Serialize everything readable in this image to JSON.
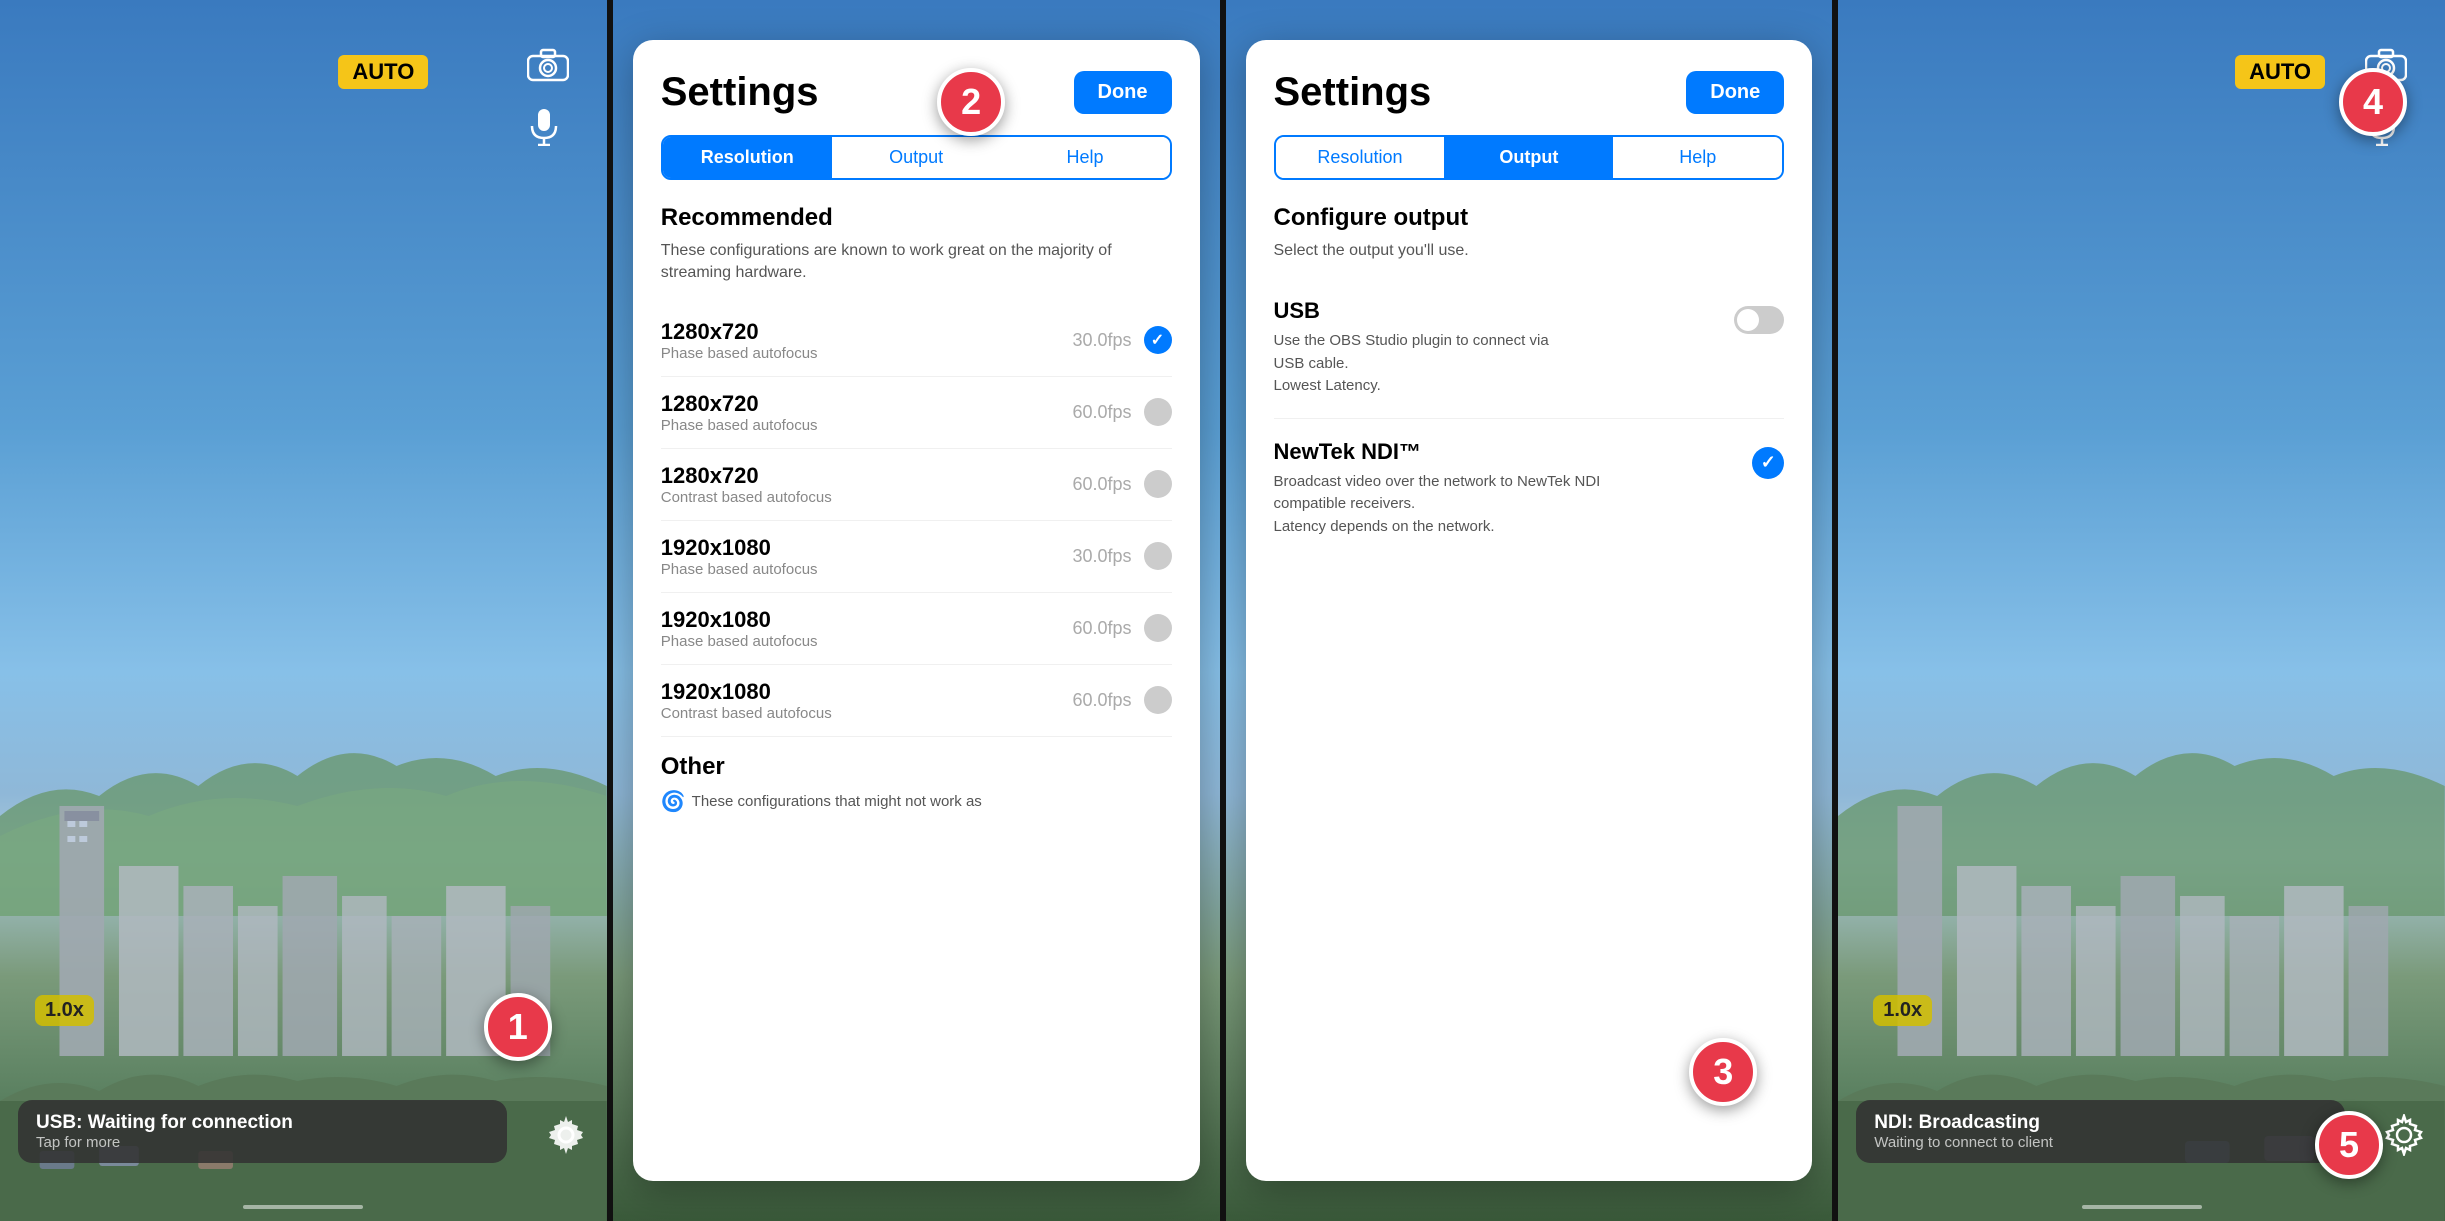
{
  "panels": {
    "panel1": {
      "type": "camera",
      "auto_badge": "AUTO",
      "zoom_badge": "1.0x",
      "status_main": "USB: Waiting for connection",
      "status_sub": "Tap for more",
      "step_number": "1"
    },
    "panel2": {
      "type": "settings",
      "title": "Settings",
      "done_label": "Done",
      "step_number": "2",
      "active_tab": "Resolution",
      "tabs": [
        "Resolution",
        "Output",
        "Help"
      ],
      "recommended_title": "Recommended",
      "recommended_desc": "These configurations are known to work great on the majority of streaming hardware.",
      "resolutions": [
        {
          "res": "1280x720",
          "sub": "Phase based autofocus",
          "fps": "30.0fps",
          "selected": true
        },
        {
          "res": "1280x720",
          "sub": "Phase based autofocus",
          "fps": "60.0fps",
          "selected": false
        },
        {
          "res": "1280x720",
          "sub": "Contrast based autofocus",
          "fps": "60.0fps",
          "selected": false
        },
        {
          "res": "1920x1080",
          "sub": "Phase based autofocus",
          "fps": "30.0fps",
          "selected": false
        },
        {
          "res": "1920x1080",
          "sub": "Phase based autofocus",
          "fps": "60.0fps",
          "selected": false
        },
        {
          "res": "1920x1080",
          "sub": "Contrast based autofocus",
          "fps": "60.0fps",
          "selected": false
        }
      ],
      "other_title": "Other",
      "other_desc": "These configurations that might not work as"
    },
    "panel3": {
      "type": "settings",
      "title": "Settings",
      "done_label": "Done",
      "step_number": "3",
      "active_tab": "Output",
      "tabs": [
        "Resolution",
        "Output",
        "Help"
      ],
      "configure_title": "Configure output",
      "configure_desc": "Select the output you'll use.",
      "outputs": [
        {
          "name": "USB",
          "desc": "Use the OBS Studio plugin to connect via USB cable.\nLowest Latency.",
          "selected": false
        },
        {
          "name": "NewTek NDI™",
          "desc": "Broadcast video over the network to NewTek NDI compatible receivers.\nLatency depends on the network.",
          "selected": true
        }
      ]
    },
    "panel4": {
      "type": "camera",
      "auto_badge": "AUTO",
      "zoom_badge": "1.0x",
      "status_main": "NDI: Broadcasting",
      "status_sub": "Waiting to connect to client",
      "step_number": "4",
      "step_number_gear": "5"
    }
  },
  "colors": {
    "blue": "#007AFF",
    "red_badge": "#e8394a",
    "yellow": "#f5c518",
    "done_bg": "#007AFF"
  }
}
